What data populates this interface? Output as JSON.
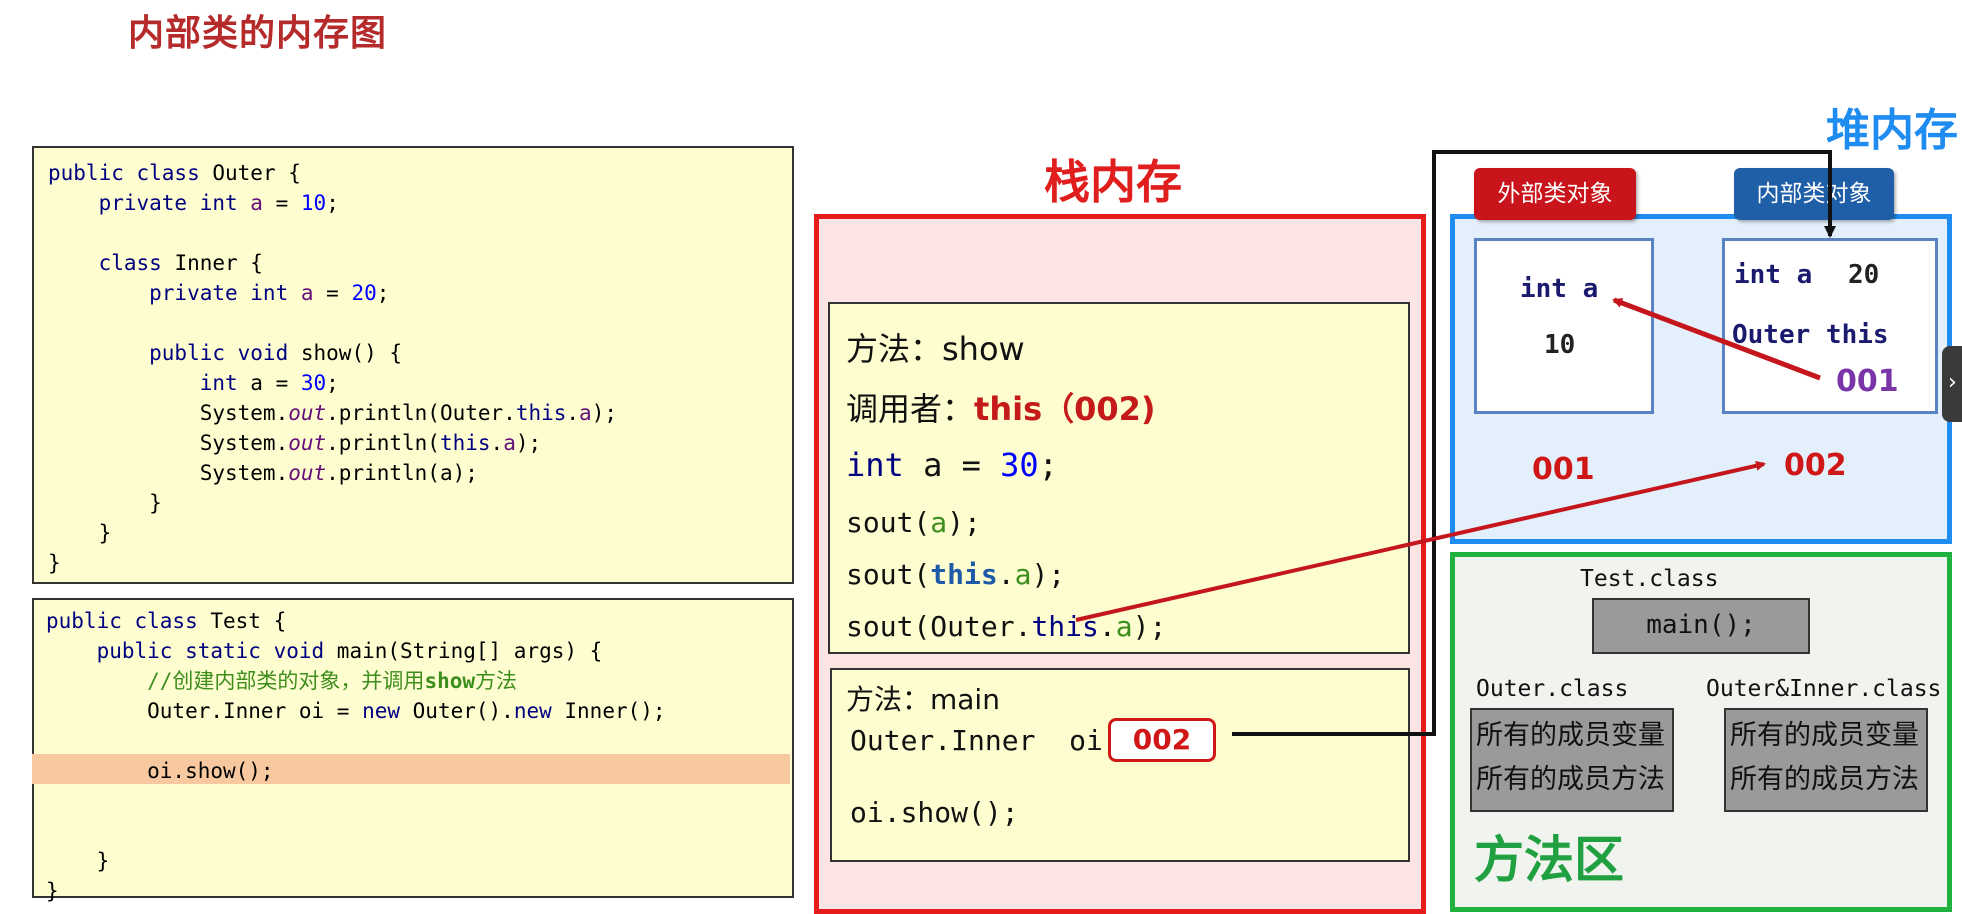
{
  "page_title": "内部类的内存图",
  "code_outer": {
    "l1_pre": "public class ",
    "l1_name": "Outer {",
    "l2_pre": "    private int ",
    "l2_var": "a",
    "l2_eq": " = ",
    "l2_num": "10",
    "l2_end": ";",
    "l4_pre": "    class ",
    "l4_name": "Inner {",
    "l5_pre": "        private int ",
    "l5_var": "a",
    "l5_eq": " = ",
    "l5_num": "20",
    "l5_end": ";",
    "l7_pre": "        public void ",
    "l7_name": "show() {",
    "l8_pre": "            int ",
    "l8_var": "a = ",
    "l8_num": "30",
    "l8_end": ";",
    "l9_pre": "            System.",
    "l9_out": "out",
    "l9_mid": ".println(Outer.",
    "l9_this": "this",
    "l9_dot": ".",
    "l9_a": "a",
    "l9_end": ");",
    "l10_pre": "            System.",
    "l10_out": "out",
    "l10_mid": ".println(",
    "l10_this": "this",
    "l10_dot": ".",
    "l10_a": "a",
    "l10_end": ");",
    "l11_pre": "            System.",
    "l11_out": "out",
    "l11_mid": ".println(a);",
    "l12": "        }",
    "l13": "    }",
    "l14": "}"
  },
  "code_test": {
    "l1_pre": "public class ",
    "l1_name": "Test {",
    "l2_pre": "    public static void ",
    "l2_name": "main(String[] args) {",
    "l3_comment": "        //创建内部类的对象，并调用",
    "l3_bold": "show",
    "l3_tail": "方法",
    "l4_pre": "        Outer.Inner oi = ",
    "l4_new1": "new",
    "l4_mid": " Outer().",
    "l4_new2": "new",
    "l4_end": " Inner();",
    "l6": "        oi.show();",
    "l9": "    }",
    "l10": "}"
  },
  "stack": {
    "heading": "栈内存",
    "show_frame": {
      "method": "方法：show",
      "caller_label": "调用者：",
      "caller_value": "this（002)",
      "int_pre": "int",
      "int_mid": " a = ",
      "int_num": "30",
      "int_end": ";",
      "sout1_pre": "sout(",
      "sout1_a": "a",
      "sout1_end": ");",
      "sout2_pre": "sout(",
      "sout2_this": "this",
      "sout2_dot": ".",
      "sout2_a": "a",
      "sout2_end": ");",
      "sout3_pre": "sout(Outer.",
      "sout3_this": "this",
      "sout3_dot": ".",
      "sout3_a": "a",
      "sout3_end": ");"
    },
    "main_frame": {
      "method": "方法：main",
      "decl": "Outer.Inner  oi",
      "ref": "002",
      "call": "oi.show();"
    }
  },
  "heap": {
    "heading": "堆内存",
    "outer_tag": "外部类对象",
    "inner_tag": "内部类对象",
    "outer_obj": {
      "field": "int a",
      "value": "10",
      "addr": "001"
    },
    "inner_obj": {
      "field": "int a",
      "value": "20",
      "this_label": "Outer this",
      "this_value": "001",
      "addr": "002"
    }
  },
  "method_area": {
    "heading": "方法区",
    "test_class": "Test.class",
    "main": "main();",
    "outer_class": "Outer.class",
    "outer_inner_class": "Outer&Inner.class",
    "members_vars": "所有的成员变量",
    "members_methods": "所有的成员方法"
  },
  "colors": {
    "arrow": "#c4161c",
    "stack_border": "#e61c1c",
    "heap_border": "#1e8cf0",
    "method_border": "#20b040"
  }
}
